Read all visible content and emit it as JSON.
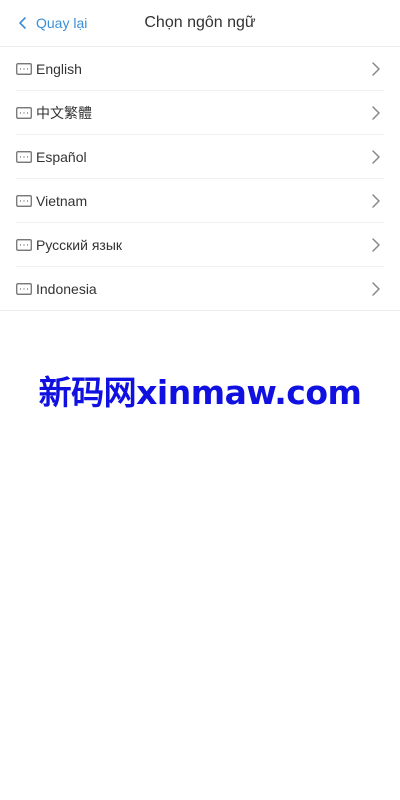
{
  "header": {
    "back_label": "Quay lại",
    "title": "Chọn ngôn ngữ"
  },
  "languages": [
    {
      "label": "English"
    },
    {
      "label": "中文繁體"
    },
    {
      "label": "Español"
    },
    {
      "label": "Vietnam"
    },
    {
      "label": "Русский язык"
    },
    {
      "label": "Indonesia"
    }
  ],
  "watermark": {
    "text": "新码网xinmaw.com"
  },
  "colors": {
    "accent": "#3b8fd6",
    "text": "#333333",
    "divider": "#f0f0f0",
    "watermark": "#1010e0"
  },
  "icons": {
    "back": "chevron-left-icon",
    "language": "keyboard-icon",
    "row_arrow": "chevron-right-icon"
  }
}
